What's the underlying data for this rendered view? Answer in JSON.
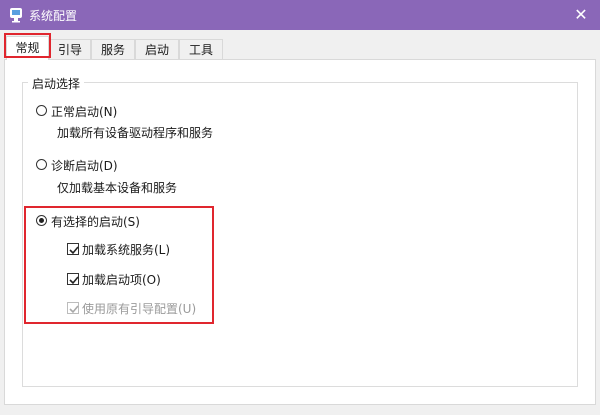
{
  "window": {
    "title": "系统配置",
    "close_glyph": "✕"
  },
  "tabs": [
    {
      "label": "常规",
      "active": true
    },
    {
      "label": "引导",
      "active": false
    },
    {
      "label": "服务",
      "active": false
    },
    {
      "label": "启动",
      "active": false
    },
    {
      "label": "工具",
      "active": false
    }
  ],
  "startup_group": {
    "title": "启动选择",
    "normal": {
      "label": "正常启动(N)",
      "description": "加载所有设备驱动程序和服务",
      "selected": false
    },
    "diagnostic": {
      "label": "诊断启动(D)",
      "description": "仅加载基本设备和服务",
      "selected": false
    },
    "selective": {
      "label": "有选择的启动(S)",
      "selected": true,
      "options": [
        {
          "label": "加载系统服务(L)",
          "checked": true,
          "enabled": true
        },
        {
          "label": "加载启动项(O)",
          "checked": true,
          "enabled": true
        },
        {
          "label": "使用原有引导配置(U)",
          "checked": true,
          "enabled": false
        }
      ]
    }
  },
  "colors": {
    "titlebar": "#8a67b8",
    "highlight": "#e0262e"
  },
  "icons": {
    "app": "system-config-icon",
    "close": "close-icon"
  }
}
